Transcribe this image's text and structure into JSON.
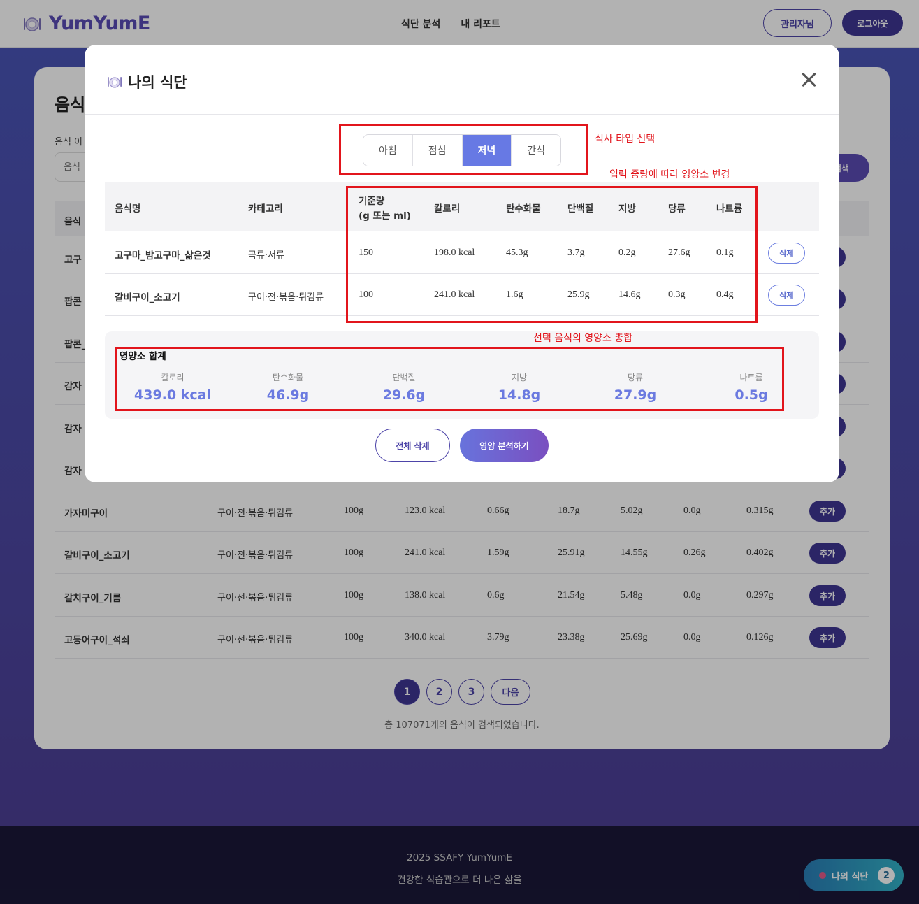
{
  "header": {
    "logo": "YumYumE",
    "nav": [
      "식단 분석",
      "내 리포트"
    ],
    "admin_label": "관리자님",
    "logout_label": "로그아웃"
  },
  "card": {
    "title": "음식",
    "search_label": "음식 이",
    "search_placeholder": "음식",
    "search_button": "검색",
    "columns": [
      "음식"
    ],
    "rows": [
      {
        "name": "고구",
        "category": "",
        "amount": "",
        "kcal": "",
        "carb": "",
        "protein": "",
        "fat": "",
        "sugar": "",
        "sodium": ""
      },
      {
        "name": "팝콘",
        "category": "",
        "amount": "",
        "kcal": "",
        "carb": "",
        "protein": "",
        "fat": "",
        "sugar": "",
        "sodium": ""
      },
      {
        "name": "팝콘_",
        "category": "",
        "amount": "",
        "kcal": "",
        "carb": "",
        "protein": "",
        "fat": "",
        "sugar": "",
        "sodium": ""
      },
      {
        "name": "감자",
        "category": "",
        "amount": "",
        "kcal": "",
        "carb": "",
        "protein": "",
        "fat": "",
        "sugar": "",
        "sodium": ""
      },
      {
        "name": "감자",
        "category": "",
        "amount": "",
        "kcal": "",
        "carb": "",
        "protein": "",
        "fat": "",
        "sugar": "",
        "sodium": ""
      },
      {
        "name": "감자",
        "category": "",
        "amount": "",
        "kcal": "",
        "carb": "",
        "protein": "",
        "fat": "",
        "sugar": "",
        "sodium": ""
      },
      {
        "name": "가자미구이",
        "category": "구이·전·볶음·튀김류",
        "amount": "100g",
        "kcal": "123.0 kcal",
        "carb": "0.66g",
        "protein": "18.7g",
        "fat": "5.02g",
        "sugar": "0.0g",
        "sodium": "0.315g"
      },
      {
        "name": "갈비구이_소고기",
        "category": "구이·전·볶음·튀김류",
        "amount": "100g",
        "kcal": "241.0 kcal",
        "carb": "1.59g",
        "protein": "25.91g",
        "fat": "14.55g",
        "sugar": "0.26g",
        "sodium": "0.402g"
      },
      {
        "name": "갈치구이_기름",
        "category": "구이·전·볶음·튀김류",
        "amount": "100g",
        "kcal": "138.0 kcal",
        "carb": "0.6g",
        "protein": "21.54g",
        "fat": "5.48g",
        "sugar": "0.0g",
        "sodium": "0.297g"
      },
      {
        "name": "고등어구이_석쇠",
        "category": "구이·전·볶음·튀김류",
        "amount": "100g",
        "kcal": "340.0 kcal",
        "carb": "3.79g",
        "protein": "23.38g",
        "fat": "25.69g",
        "sugar": "0.0g",
        "sodium": "0.126g"
      }
    ],
    "add_label": "추가",
    "pages": [
      "1",
      "2",
      "3"
    ],
    "next_label": "다음",
    "total_text": "총 107071개의 음식이 검색되었습니다."
  },
  "footer": {
    "line1": "2025 SSAFY YumYumE",
    "line2": "건강한 식습관으로 더 나은 삶을"
  },
  "floating": {
    "label": "나의 식단",
    "count": "2"
  },
  "modal": {
    "title": "나의 식단",
    "meal_tabs": [
      "아침",
      "점심",
      "저녁",
      "간식"
    ],
    "active_tab": "저녁",
    "columns": {
      "name": "음식명",
      "category": "카테고리",
      "amount_1": "기준량",
      "amount_2": "(g 또는 ml)",
      "kcal": "칼로리",
      "carb": "탄수화물",
      "protein": "단백질",
      "fat": "지방",
      "sugar": "당류",
      "sodium": "나트륨"
    },
    "rows": [
      {
        "name": "고구마_밤고구마_삶은것",
        "category": "곡류·서류",
        "amount": "150",
        "kcal": "198.0 kcal",
        "carb": "45.3g",
        "protein": "3.7g",
        "fat": "0.2g",
        "sugar": "27.6g",
        "sodium": "0.1g"
      },
      {
        "name": "갈비구이_소고기",
        "category": "구이·전·볶음·튀김류",
        "amount": "100",
        "kcal": "241.0 kcal",
        "carb": "1.6g",
        "protein": "25.9g",
        "fat": "14.6g",
        "sugar": "0.3g",
        "sodium": "0.4g"
      }
    ],
    "delete_label": "삭제",
    "summary": {
      "title": "영양소 합계",
      "items": [
        {
          "label": "칼로리",
          "value": "439.0 kcal"
        },
        {
          "label": "탄수화물",
          "value": "46.9g"
        },
        {
          "label": "단백질",
          "value": "29.6g"
        },
        {
          "label": "지방",
          "value": "14.8g"
        },
        {
          "label": "당류",
          "value": "27.9g"
        },
        {
          "label": "나트륨",
          "value": "0.5g"
        }
      ]
    },
    "clear_label": "전체 삭제",
    "analyze_label": "영양 분석하기"
  },
  "annotations": {
    "meal_type": "식사 타입 선택",
    "amount_change": "입력 중량에 따라 영양소 변경",
    "sum": "선택 음식의 영양소 총합",
    "color": "#e2151c"
  }
}
